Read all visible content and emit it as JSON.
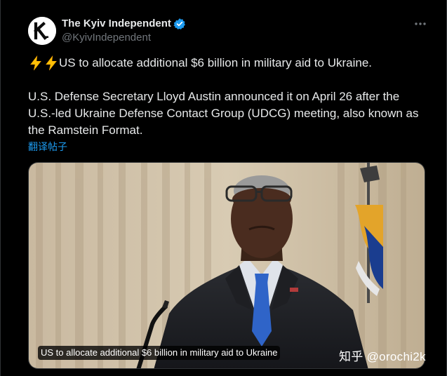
{
  "account": {
    "display_name": "The Kyiv Independent",
    "handle": "@KyivIndependent",
    "avatar_letter": "K",
    "verified_color": "#1d9bf0"
  },
  "tweet": {
    "headline": "US to allocate additional $6 billion in military aid to Ukraine.",
    "emoji": "lightning-bolt",
    "paragraph_line1": "U.S. Defense Secretary Lloyd Austin announced it on April 26 after the",
    "paragraph_line2": "U.S.-led Ukraine Defense Contact Group (UDCG) meeting, also known as",
    "paragraph_line3": "the Ramstein Format.",
    "translate_label": "翻译帖子"
  },
  "media": {
    "caption": "US to allocate additional $6 billion in military aid to Ukraine"
  },
  "overlay": {
    "watermark": "知乎 @orochi2k"
  },
  "colors": {
    "background": "#000000",
    "text": "#e7e9ea",
    "secondary": "#71767b",
    "accent": "#1d9bf0"
  }
}
